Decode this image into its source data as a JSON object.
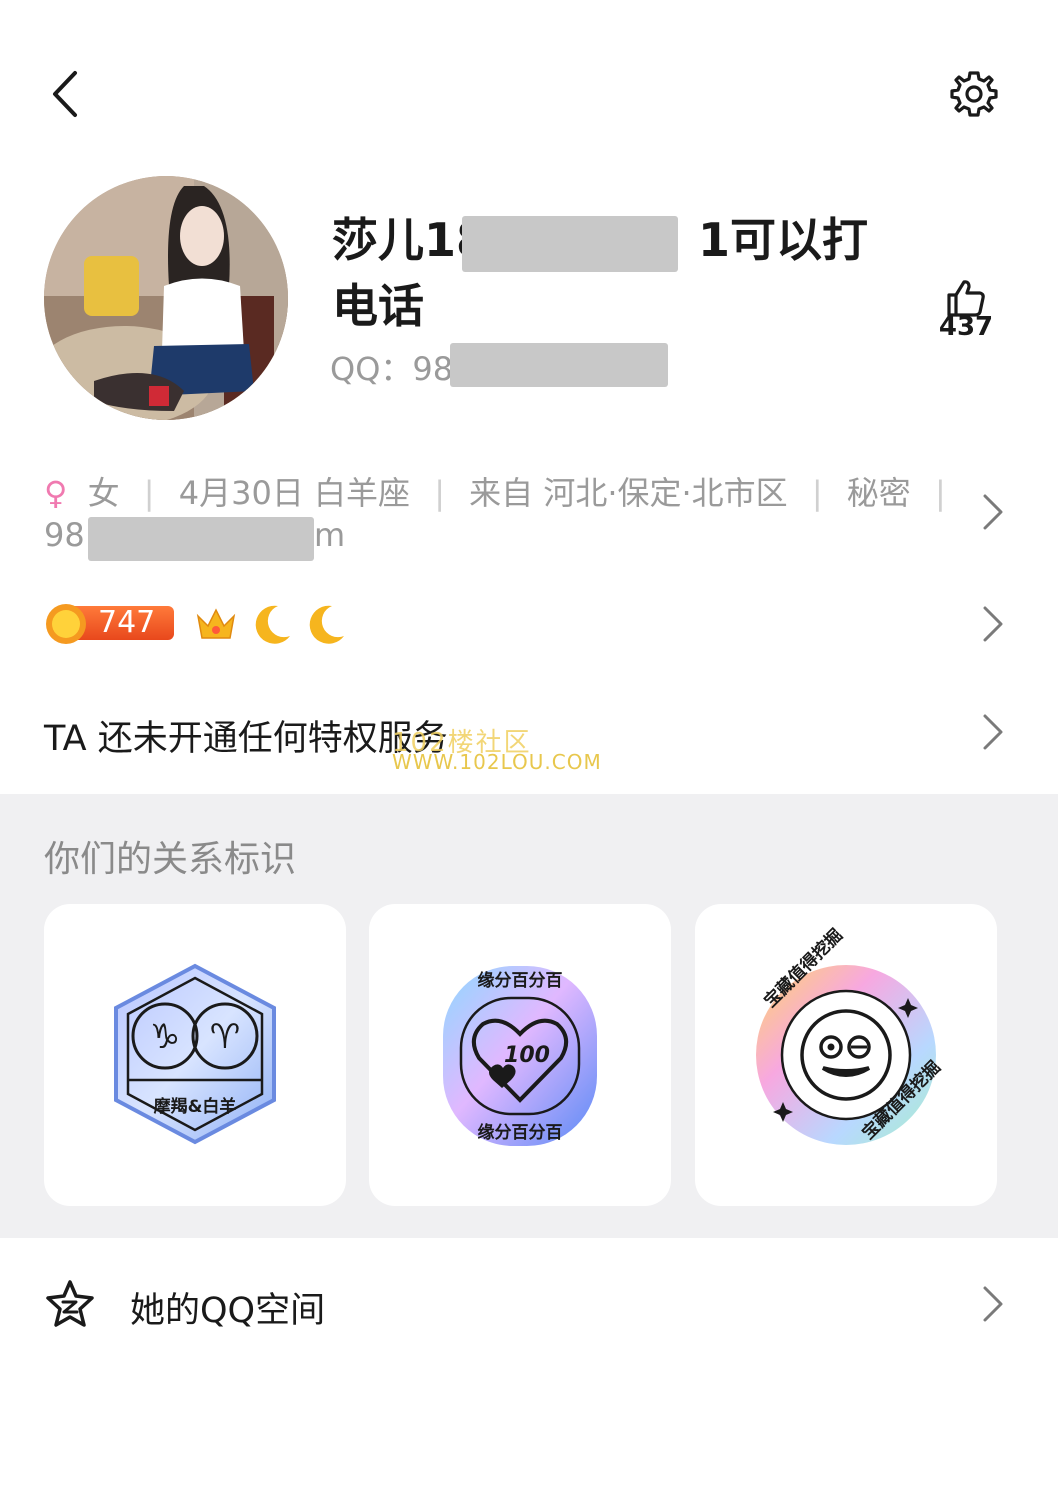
{
  "header": {
    "back_icon": "chevron-left-icon",
    "settings_icon": "gear-icon"
  },
  "profile": {
    "name_part1": "莎儿18",
    "name_part2": "1可以打",
    "name_line2": "电话",
    "qq_label": "QQ：98",
    "like_count": "437"
  },
  "info": {
    "gender_symbol": "♀",
    "gender": "女",
    "birthday": "4月30日 白羊座",
    "location": "来自 河北·保定·北市区",
    "secret": "秘密",
    "email_prefix": "98",
    "email_suffix": "m"
  },
  "level": {
    "value": "747"
  },
  "privilege": {
    "text": "TA 还未开通任何特权服务"
  },
  "watermark": {
    "line1": "102楼社区",
    "line2": "WWW.102LOU.COM"
  },
  "relation": {
    "title": "你们的关系标识",
    "badge1_label": "摩羯&白羊",
    "badge2_top": "缘分百分百",
    "badge2_bottom": "缘分百分百",
    "badge2_center": "100",
    "badge3_top": "宝藏值得挖掘",
    "badge3_bottom": "宝藏值得挖掘"
  },
  "qzone": {
    "label": "她的QQ空间"
  },
  "colors": {
    "gender_pink": "#f07ab0",
    "level_orange": "#f26a2e",
    "gray_bg": "#f0f0f2"
  }
}
